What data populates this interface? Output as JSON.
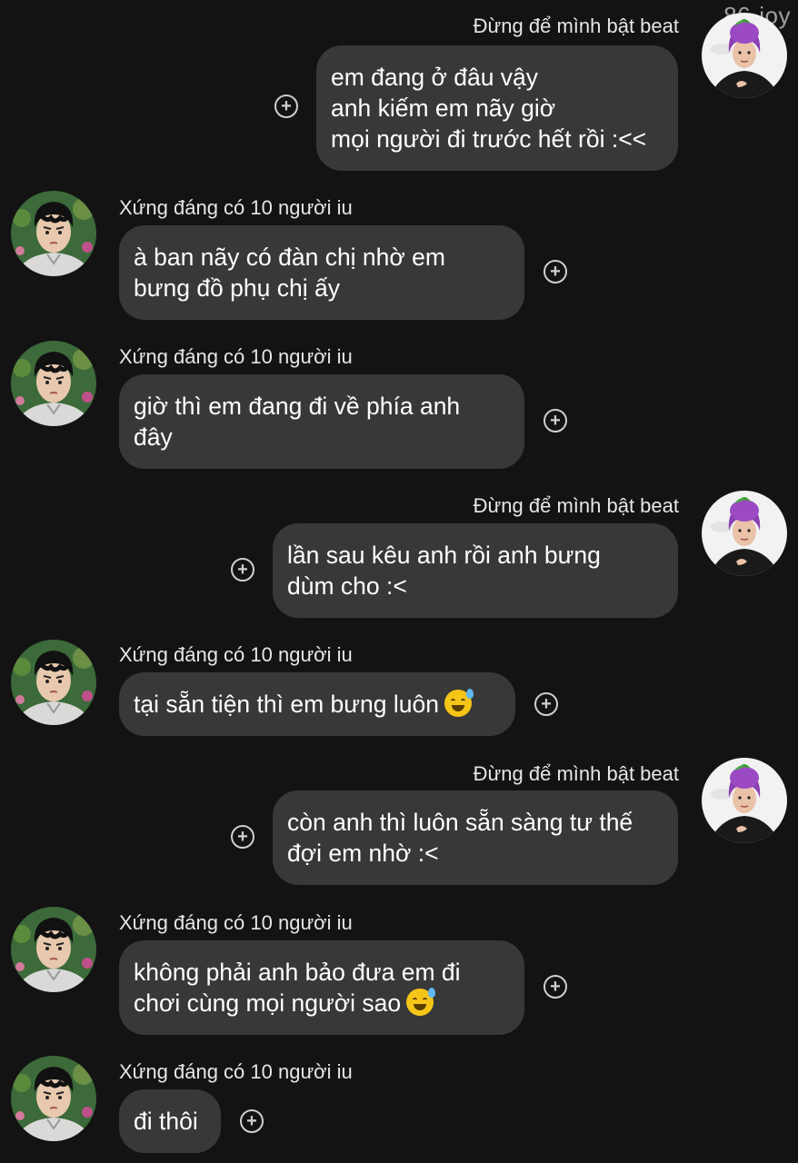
{
  "watermark": "86·joy",
  "contacts": {
    "me": "Đừng để mình bật beat",
    "other": "Xứng đáng có 10 người iu"
  },
  "icons": {
    "reaction": "add-reaction-icon",
    "emoji": "grinning-sweat-emoji"
  },
  "messages": [
    {
      "sender": "Đừng để mình bật beat",
      "lines": [
        "em đang ở đâu vậy",
        "anh kiếm em nãy giờ",
        "mọi người đi trước hết rồi :<<"
      ]
    },
    {
      "sender": "Xứng đáng có 10 người iu",
      "lines": [
        "à ban nãy có đàn chị nhờ em",
        "bưng đồ phụ chị ấy"
      ]
    },
    {
      "sender": "Xứng đáng có 10 người iu",
      "lines": [
        "giờ thì em đang đi về phía anh",
        "đây"
      ]
    },
    {
      "sender": "Đừng để mình bật beat",
      "lines": [
        "lần sau kêu anh rồi anh bưng",
        "dùm cho :<"
      ]
    },
    {
      "sender": "Xứng đáng có 10 người iu",
      "lines": [
        "tại sẵn tiện thì em bưng luôn"
      ]
    },
    {
      "sender": "Đừng để mình bật beat",
      "lines": [
        "còn anh thì luôn sẵn sàng tư thế",
        "đợi em nhờ :<"
      ]
    },
    {
      "sender": "Xứng đáng có 10 người iu",
      "lines": [
        "không phải anh bảo đưa em đi",
        "chơi cùng mọi người sao"
      ]
    },
    {
      "sender": "Xứng đáng có 10 người iu",
      "lines": [
        "đi thôi"
      ]
    }
  ]
}
